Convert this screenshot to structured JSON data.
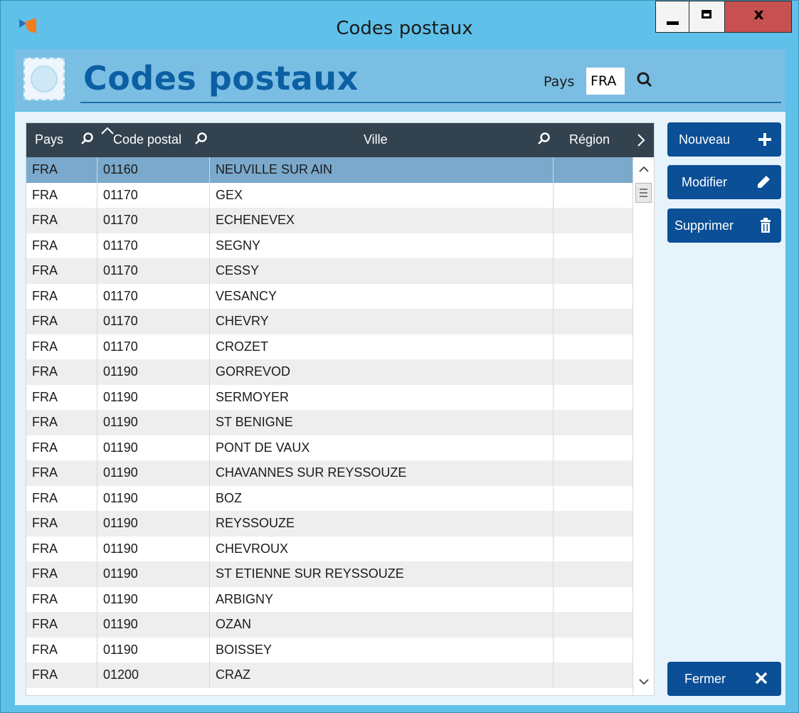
{
  "window": {
    "title": "Codes postaux"
  },
  "header": {
    "title": "Codes postaux",
    "pays_label": "Pays",
    "pays_value": "FRA"
  },
  "grid": {
    "columns": [
      "Pays",
      "Code postal",
      "Ville",
      "Région"
    ],
    "rows": [
      {
        "pays": "FRA",
        "code": "01160",
        "ville": "NEUVILLE SUR AIN",
        "region": ""
      },
      {
        "pays": "FRA",
        "code": "01170",
        "ville": "GEX",
        "region": ""
      },
      {
        "pays": "FRA",
        "code": "01170",
        "ville": "ECHENEVEX",
        "region": ""
      },
      {
        "pays": "FRA",
        "code": "01170",
        "ville": "SEGNY",
        "region": ""
      },
      {
        "pays": "FRA",
        "code": "01170",
        "ville": "CESSY",
        "region": ""
      },
      {
        "pays": "FRA",
        "code": "01170",
        "ville": "VESANCY",
        "region": ""
      },
      {
        "pays": "FRA",
        "code": "01170",
        "ville": "CHEVRY",
        "region": ""
      },
      {
        "pays": "FRA",
        "code": "01170",
        "ville": "CROZET",
        "region": ""
      },
      {
        "pays": "FRA",
        "code": "01190",
        "ville": "GORREVOD",
        "region": ""
      },
      {
        "pays": "FRA",
        "code": "01190",
        "ville": "SERMOYER",
        "region": ""
      },
      {
        "pays": "FRA",
        "code": "01190",
        "ville": "ST BENIGNE",
        "region": ""
      },
      {
        "pays": "FRA",
        "code": "01190",
        "ville": "PONT DE VAUX",
        "region": ""
      },
      {
        "pays": "FRA",
        "code": "01190",
        "ville": "CHAVANNES SUR REYSSOUZE",
        "region": ""
      },
      {
        "pays": "FRA",
        "code": "01190",
        "ville": "BOZ",
        "region": ""
      },
      {
        "pays": "FRA",
        "code": "01190",
        "ville": "REYSSOUZE",
        "region": ""
      },
      {
        "pays": "FRA",
        "code": "01190",
        "ville": "CHEVROUX",
        "region": ""
      },
      {
        "pays": "FRA",
        "code": "01190",
        "ville": "ST ETIENNE SUR REYSSOUZE",
        "region": ""
      },
      {
        "pays": "FRA",
        "code": "01190",
        "ville": "ARBIGNY",
        "region": ""
      },
      {
        "pays": "FRA",
        "code": "01190",
        "ville": "OZAN",
        "region": ""
      },
      {
        "pays": "FRA",
        "code": "01190",
        "ville": "BOISSEY",
        "region": ""
      },
      {
        "pays": "FRA",
        "code": "01200",
        "ville": "CRAZ",
        "region": ""
      }
    ],
    "selected_index": 0
  },
  "actions": {
    "new_label": "Nouveau",
    "edit_label": "Modifier",
    "delete_label": "Supprimer",
    "close_label": "Fermer"
  },
  "colors": {
    "titlebar": "#5fc1ea",
    "header_band": "#7bbee3",
    "grid_header": "#33424f",
    "selected_row": "#7ba9cb",
    "button": "#0b4f96",
    "title_text": "#0b5fa3"
  }
}
